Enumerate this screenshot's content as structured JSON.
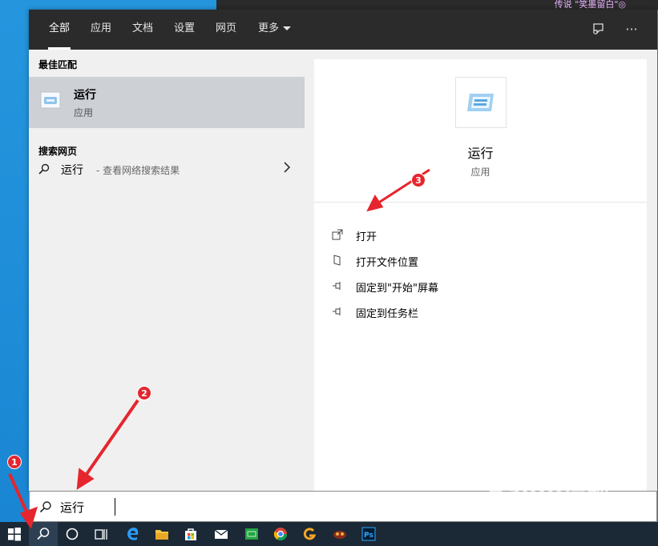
{
  "desktop": {
    "caption": "传说 \"笑墨留白\"◎"
  },
  "header": {
    "tabs": [
      {
        "label": "全部",
        "active": true
      },
      {
        "label": "应用"
      },
      {
        "label": "文档"
      },
      {
        "label": "设置"
      },
      {
        "label": "网页"
      },
      {
        "label": "更多"
      }
    ],
    "feedback_icon": "feedback-icon",
    "more_options_icon": "ellipsis-icon",
    "more_options_glyph": "···"
  },
  "left": {
    "best_match_title": "最佳匹配",
    "best_match": {
      "name": "运行",
      "type": "应用",
      "icon": "run-app-icon"
    },
    "web_title": "搜索网页",
    "web_result": {
      "name": "运行",
      "desc": "- 查看网络搜索结果"
    }
  },
  "detail": {
    "name": "运行",
    "type": "应用",
    "actions": [
      {
        "label": "打开",
        "icon": "open-icon"
      },
      {
        "label": "打开文件位置",
        "icon": "file-location-icon"
      },
      {
        "label": "固定到\"开始\"屏幕",
        "icon": "pin-icon"
      },
      {
        "label": "固定到任务栏",
        "icon": "pin-icon"
      }
    ]
  },
  "search": {
    "value": "运行"
  },
  "taskbar": {
    "items": [
      "windows-start",
      "search",
      "cortana",
      "task-view",
      "edge",
      "file-explorer",
      "store",
      "mail",
      "green-app",
      "chrome",
      "g-app",
      "game-app",
      "photoshop"
    ],
    "photoshop_label": "Ps"
  },
  "annotations": {
    "m1": "1",
    "m2": "2",
    "m3": "3"
  },
  "watermark": {
    "logo": "Baidu经验",
    "site": "jingyan.baidu.com"
  },
  "colors": {
    "accent": "#0078d7",
    "header": "#2b2b2b",
    "selected": "#cdd0d5",
    "marker": "#e5262e",
    "taskbar": "#1b2836"
  }
}
